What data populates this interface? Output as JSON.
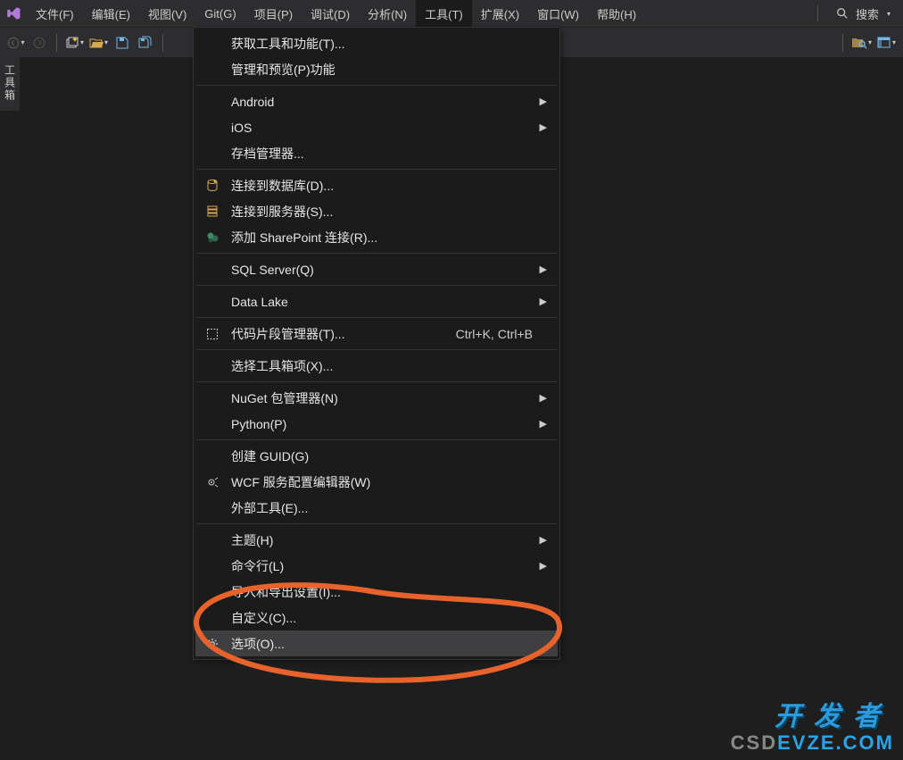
{
  "menubar": {
    "items": [
      "文件(F)",
      "编辑(E)",
      "视图(V)",
      "Git(G)",
      "项目(P)",
      "调试(D)",
      "分析(N)",
      "工具(T)",
      "扩展(X)",
      "窗口(W)",
      "帮助(H)"
    ],
    "open_index": 7,
    "search_label": "搜索"
  },
  "side_tab": {
    "label": "工具箱"
  },
  "dropdown": {
    "groups": [
      [
        {
          "label": "获取工具和功能(T)...",
          "icon": null
        },
        {
          "label": "管理和预览(P)功能",
          "icon": null
        }
      ],
      [
        {
          "label": "Android",
          "icon": null,
          "submenu": true
        },
        {
          "label": "iOS",
          "icon": null,
          "submenu": true
        },
        {
          "label": "存档管理器...",
          "icon": null
        }
      ],
      [
        {
          "label": "连接到数据库(D)...",
          "icon": "db"
        },
        {
          "label": "连接到服务器(S)...",
          "icon": "server"
        },
        {
          "label": "添加 SharePoint 连接(R)...",
          "icon": "sp"
        }
      ],
      [
        {
          "label": "SQL Server(Q)",
          "icon": null,
          "submenu": true
        }
      ],
      [
        {
          "label": "Data Lake",
          "icon": null,
          "submenu": true
        }
      ],
      [
        {
          "label": "代码片段管理器(T)...",
          "icon": "snippet",
          "shortcut": "Ctrl+K, Ctrl+B"
        }
      ],
      [
        {
          "label": "选择工具箱项(X)...",
          "icon": null
        }
      ],
      [
        {
          "label": "NuGet 包管理器(N)",
          "icon": null,
          "submenu": true
        },
        {
          "label": "Python(P)",
          "icon": null,
          "submenu": true
        }
      ],
      [
        {
          "label": "创建 GUID(G)",
          "icon": null
        },
        {
          "label": "WCF 服务配置编辑器(W)",
          "icon": "wcf"
        },
        {
          "label": "外部工具(E)...",
          "icon": null
        }
      ],
      [
        {
          "label": "主题(H)",
          "icon": null,
          "submenu": true
        },
        {
          "label": "命令行(L)",
          "icon": null,
          "submenu": true
        },
        {
          "label": "导入和导出设置(I)...",
          "icon": null
        },
        {
          "label": "自定义(C)...",
          "icon": null
        },
        {
          "label": "选项(O)...",
          "icon": "gear",
          "highlight": true
        }
      ]
    ]
  },
  "watermark": {
    "cn": "开发者",
    "en_gray": "CSD",
    "en_color": "EVZE.COM"
  }
}
